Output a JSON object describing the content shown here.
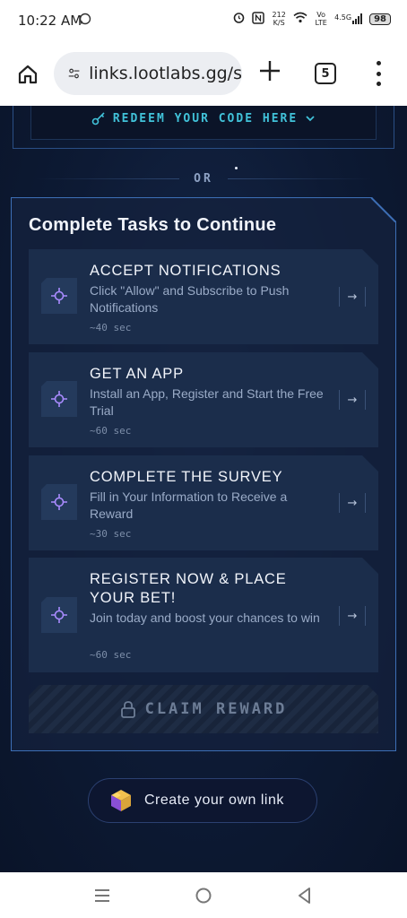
{
  "status_bar": {
    "time": "10:22 AM",
    "network_speed": "212 K/S",
    "network_type": "Vo LTE",
    "signal": "4.5G",
    "battery": "98"
  },
  "browser": {
    "url": "links.lootlabs.gg/s",
    "tab_count": "5"
  },
  "redeem": {
    "label": "REDEEM YOUR CODE HERE"
  },
  "divider": {
    "label": "OR"
  },
  "tasks_panel": {
    "title": "Complete Tasks to Continue",
    "tasks": [
      {
        "title": "ACCEPT NOTIFICATIONS",
        "description": "Click \"Allow\" and Subscribe to Push Notifications",
        "duration": "~40 sec"
      },
      {
        "title": "GET AN APP",
        "description": "Install an App, Register and Start the Free Trial",
        "duration": "~60 sec"
      },
      {
        "title": "COMPLETE THE SURVEY",
        "description": "Fill in Your Information to Receive a Reward",
        "duration": "~30 sec"
      },
      {
        "title": "REGISTER NOW & PLACE YOUR BET!",
        "description": "Join today and boost your chances to win",
        "duration": "~60 sec"
      }
    ],
    "claim_label": "CLAIM REWARD"
  },
  "create_link": {
    "label": "Create your own link"
  },
  "icons": {
    "task_icon": "crosshair-icon",
    "arrow": "arrow-right-icon",
    "lock": "lock-icon",
    "key": "key-icon"
  },
  "colors": {
    "accent_cyan": "#41c2d9",
    "accent_purple": "#a98bff",
    "panel_border": "#3d6fb6",
    "background": "#0e1a33"
  }
}
